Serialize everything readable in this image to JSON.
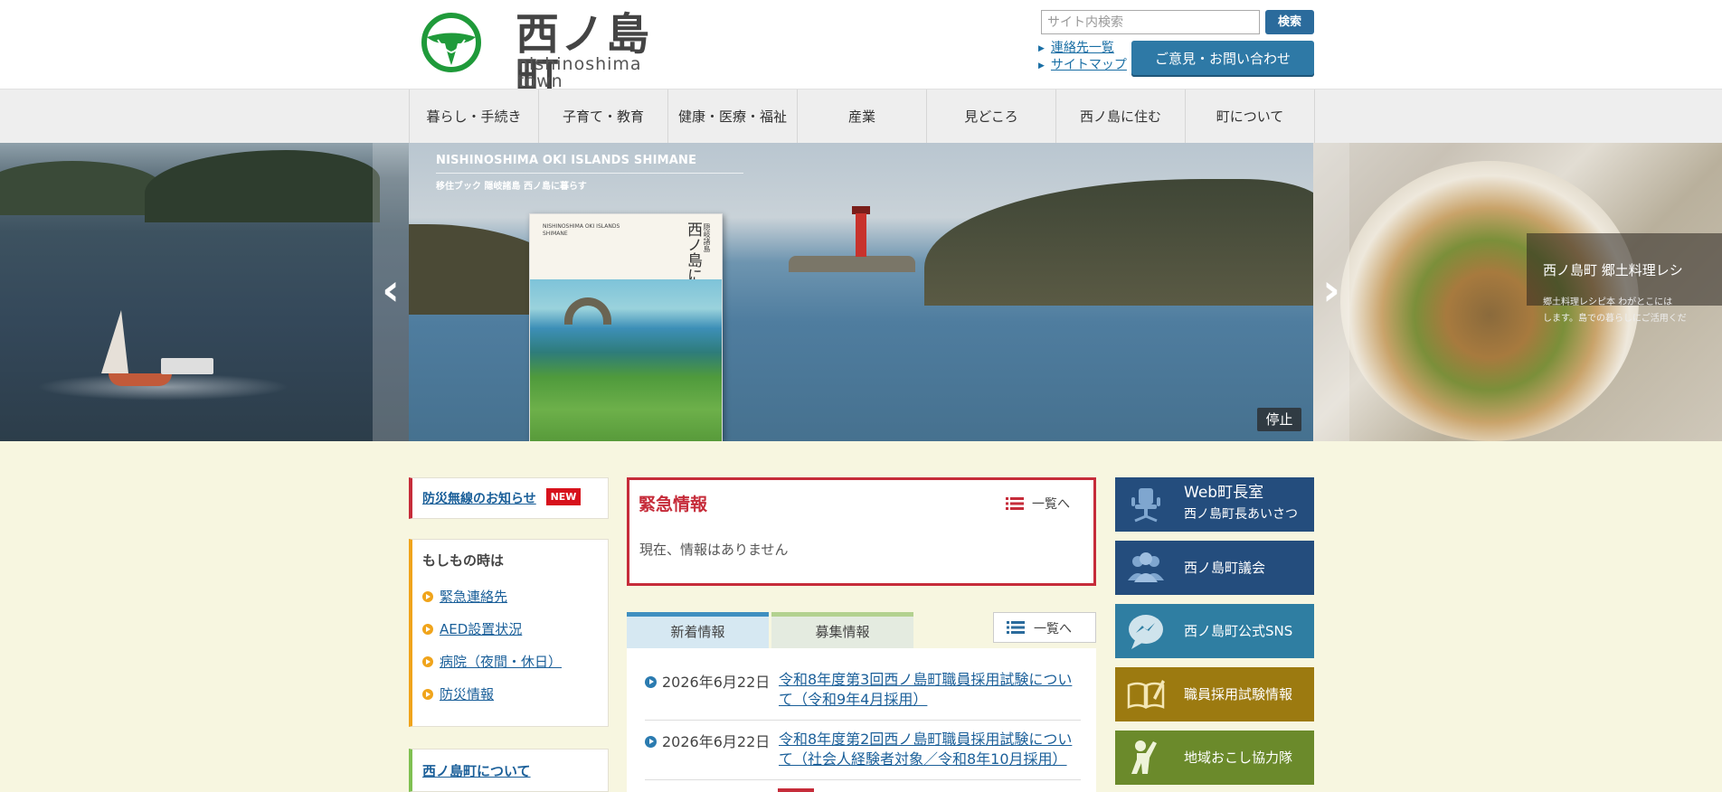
{
  "header": {
    "logo_title": "西ノ島町",
    "logo_subtitle": "nishinoshima town",
    "search_placeholder": "サイト内検索",
    "search_button": "検索",
    "util_links": [
      "連絡先一覧",
      "サイトマップ"
    ],
    "contact_button": "ご意見・お問い合わせ"
  },
  "nav": {
    "items": [
      "暮らし・手続き",
      "子育て・教育",
      "健康・医療・福祉",
      "産業",
      "見どころ",
      "西ノ島に住む",
      "町について"
    ]
  },
  "slider": {
    "kicker": "NISHINOSHIMA OKI ISLANDS SHIMANE",
    "caption": "移住ブック 隠岐諸島 西ノ島に暮らす",
    "book_top_text": "NISHINOSHIMA OKI ISLANDS SHIMANE",
    "book_title": "西ノ島に暮らす",
    "book_label": "隠岐諸島",
    "right_title": "西ノ島町 郷土料理レシ",
    "right_text_1": "郷土料理レシピ本 わがとこには",
    "right_text_2": "します。島での暮らしにご活用くだ",
    "prev_label": "‹",
    "next_label": "›",
    "stop_label": "停止"
  },
  "left": {
    "alert_link": "防災無線のお知らせ",
    "new_badge": "NEW",
    "emergency_title": "もしもの時は",
    "emergency_items": [
      "緊急連絡先",
      "AED設置状況",
      "病院（夜間・休日）",
      "防災情報"
    ],
    "about_link": "西ノ島町について"
  },
  "center": {
    "urgent_title": "緊急情報",
    "list_link": "一覧へ",
    "urgent_empty": "現在、情報はありません",
    "tabs": [
      "新着情報",
      "募集情報"
    ],
    "news": [
      {
        "date": "2026年6月22日",
        "title": "令和8年度第3回西ノ島町職員採用試験について（令和9年4月採用）"
      },
      {
        "date": "2026年6月22日",
        "title": "令和8年度第2回西ノ島町職員採用試験について（社会人経験者対象／令和8年10月採用）"
      }
    ]
  },
  "right": {
    "banners": [
      {
        "title": "Web町長室",
        "subtitle": "西ノ島町長あいさつ",
        "color": "#244d7d",
        "icon": "chair-icon"
      },
      {
        "title": "西ノ島町議会",
        "subtitle": "",
        "color": "#244d7d",
        "icon": "people-icon"
      },
      {
        "title": "西ノ島町公式SNS",
        "subtitle": "",
        "color": "#2f7ea2",
        "icon": "chat-bubble-icon"
      },
      {
        "title": "職員採用試験情報",
        "subtitle": "",
        "color": "#9c7a10",
        "icon": "open-book-icon"
      },
      {
        "title": "地域おこし協力隊",
        "subtitle": "",
        "color": "#6b8a2b",
        "icon": "cheering-person-icon"
      }
    ]
  },
  "colors": {
    "brand_green": "#1f9a3a",
    "alert_red": "#c62c3a",
    "link_blue": "#1a5f99",
    "accent_orange": "#f0a41b",
    "background": "#f7f6e0"
  }
}
